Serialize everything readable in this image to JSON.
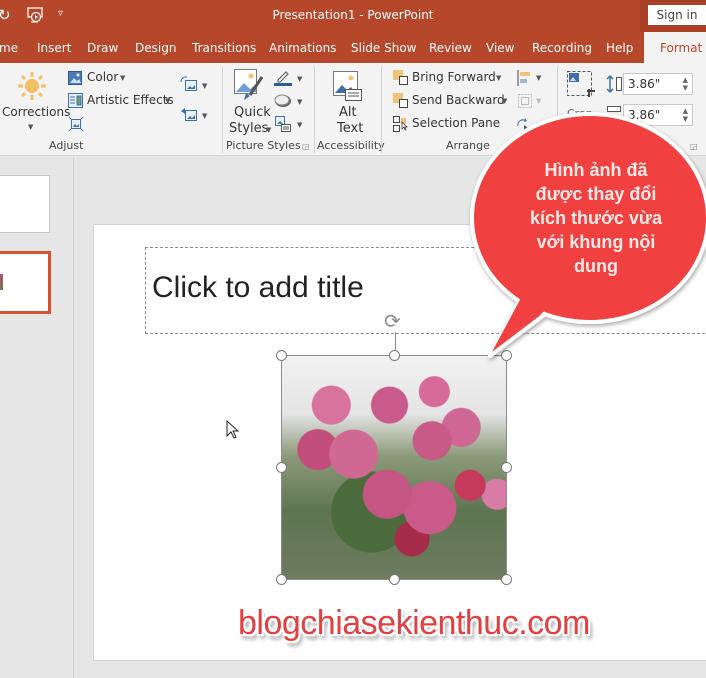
{
  "window": {
    "title": "Presentation1  -  PowerPoint",
    "sign_in": "Sign in",
    "quick_access": [
      "redo-icon",
      "present-from-start-icon",
      "customize-qat-icon"
    ]
  },
  "tabs": [
    {
      "label": "me"
    },
    {
      "label": "Insert"
    },
    {
      "label": "Draw"
    },
    {
      "label": "Design"
    },
    {
      "label": "Transitions"
    },
    {
      "label": "Animations"
    },
    {
      "label": "Slide Show"
    },
    {
      "label": "Review"
    },
    {
      "label": "View"
    },
    {
      "label": "Recording"
    },
    {
      "label": "Help"
    },
    {
      "label": "Format",
      "active": true
    }
  ],
  "ribbon": {
    "adjust": {
      "corrections": "Corrections",
      "color": "Color",
      "artistic_effects": "Artistic Effects",
      "group_label": "Adjust"
    },
    "picture_styles": {
      "quick_styles_line1": "Quick",
      "quick_styles_line2": "Styles",
      "group_label": "Picture Styles"
    },
    "accessibility": {
      "alt_text_line1": "Alt",
      "alt_text_line2": "Text",
      "group_label": "Accessibility"
    },
    "arrange": {
      "bring_forward": "Bring Forward",
      "send_backward": "Send Backward",
      "selection_pane": "Selection Pane",
      "group_label": "Arrange"
    },
    "size": {
      "height": "3.86\"",
      "width": "3.86\"",
      "crop_label": "Crop"
    }
  },
  "slide": {
    "title_placeholder": "Click to add title"
  },
  "callout": {
    "text_lines": [
      "Hình ảnh đã",
      "được thay đổi",
      "kích thước vừa",
      "với khung nội",
      "dung"
    ],
    "color": "#f04040"
  },
  "watermark": "blogchiasekienthuc.com",
  "colors": {
    "accent": "#b7472a",
    "selected_thumbnail": "#d35230"
  }
}
